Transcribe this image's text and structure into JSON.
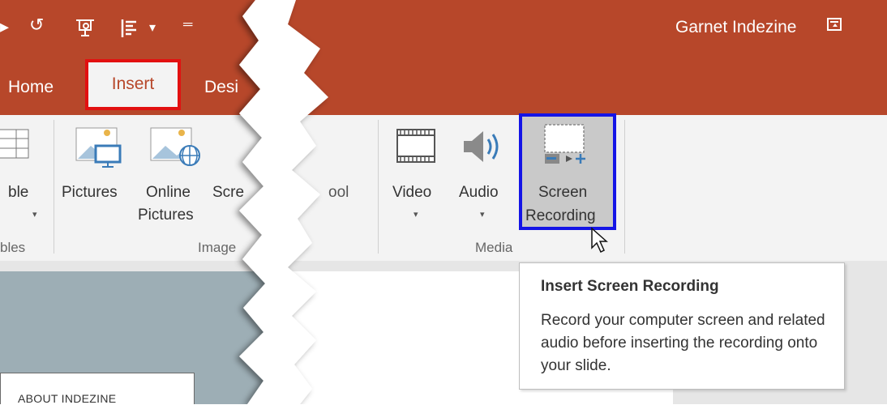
{
  "title_bar": {
    "user_name": "Garnet Indezine",
    "qat_undo": "↺",
    "qat_more": "▾",
    "qat_customize": "═"
  },
  "tabs": {
    "home": "Home",
    "insert": "Insert",
    "design": "Desi"
  },
  "ribbon": {
    "left_groups": {
      "table_label": "ble",
      "table_group": "bles",
      "pictures_label": "Pictures",
      "online_pictures_label_1": "Online",
      "online_pictures_label_2": "Pictures",
      "screenshot_label": "Scre",
      "images_group": "Image"
    },
    "media_group": {
      "partial_label": "ool",
      "video_label": "Video",
      "audio_label": "Audio",
      "screen_recording_label_1": "Screen",
      "screen_recording_label_2": "Recording",
      "group_label": "Media"
    }
  },
  "tooltip": {
    "title": "Insert Screen Recording",
    "body": "Record your computer screen and related audio before inserting the recording onto your slide."
  },
  "slide": {
    "thumb_text": "ABOUT INDEZINE"
  },
  "colors": {
    "accent": "#B7472A",
    "insert_highlight": "#E21010",
    "screen_recording_highlight": "#1414E6"
  }
}
